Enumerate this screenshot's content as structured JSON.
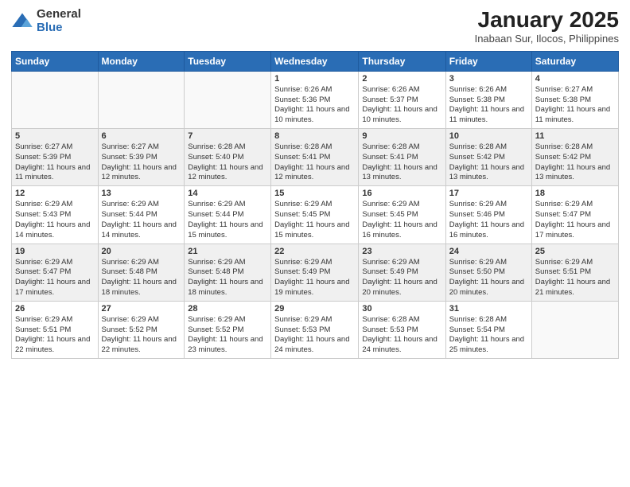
{
  "header": {
    "logo_general": "General",
    "logo_blue": "Blue",
    "title": "January 2025",
    "subtitle": "Inabaan Sur, Ilocos, Philippines"
  },
  "days_of_week": [
    "Sunday",
    "Monday",
    "Tuesday",
    "Wednesday",
    "Thursday",
    "Friday",
    "Saturday"
  ],
  "weeks": [
    [
      {
        "day": "",
        "content": ""
      },
      {
        "day": "",
        "content": ""
      },
      {
        "day": "",
        "content": ""
      },
      {
        "day": "1",
        "content": "Sunrise: 6:26 AM\nSunset: 5:36 PM\nDaylight: 11 hours and 10 minutes."
      },
      {
        "day": "2",
        "content": "Sunrise: 6:26 AM\nSunset: 5:37 PM\nDaylight: 11 hours and 10 minutes."
      },
      {
        "day": "3",
        "content": "Sunrise: 6:26 AM\nSunset: 5:38 PM\nDaylight: 11 hours and 11 minutes."
      },
      {
        "day": "4",
        "content": "Sunrise: 6:27 AM\nSunset: 5:38 PM\nDaylight: 11 hours and 11 minutes."
      }
    ],
    [
      {
        "day": "5",
        "content": "Sunrise: 6:27 AM\nSunset: 5:39 PM\nDaylight: 11 hours and 11 minutes."
      },
      {
        "day": "6",
        "content": "Sunrise: 6:27 AM\nSunset: 5:39 PM\nDaylight: 11 hours and 12 minutes."
      },
      {
        "day": "7",
        "content": "Sunrise: 6:28 AM\nSunset: 5:40 PM\nDaylight: 11 hours and 12 minutes."
      },
      {
        "day": "8",
        "content": "Sunrise: 6:28 AM\nSunset: 5:41 PM\nDaylight: 11 hours and 12 minutes."
      },
      {
        "day": "9",
        "content": "Sunrise: 6:28 AM\nSunset: 5:41 PM\nDaylight: 11 hours and 13 minutes."
      },
      {
        "day": "10",
        "content": "Sunrise: 6:28 AM\nSunset: 5:42 PM\nDaylight: 11 hours and 13 minutes."
      },
      {
        "day": "11",
        "content": "Sunrise: 6:28 AM\nSunset: 5:42 PM\nDaylight: 11 hours and 13 minutes."
      }
    ],
    [
      {
        "day": "12",
        "content": "Sunrise: 6:29 AM\nSunset: 5:43 PM\nDaylight: 11 hours and 14 minutes."
      },
      {
        "day": "13",
        "content": "Sunrise: 6:29 AM\nSunset: 5:44 PM\nDaylight: 11 hours and 14 minutes."
      },
      {
        "day": "14",
        "content": "Sunrise: 6:29 AM\nSunset: 5:44 PM\nDaylight: 11 hours and 15 minutes."
      },
      {
        "day": "15",
        "content": "Sunrise: 6:29 AM\nSunset: 5:45 PM\nDaylight: 11 hours and 15 minutes."
      },
      {
        "day": "16",
        "content": "Sunrise: 6:29 AM\nSunset: 5:45 PM\nDaylight: 11 hours and 16 minutes."
      },
      {
        "day": "17",
        "content": "Sunrise: 6:29 AM\nSunset: 5:46 PM\nDaylight: 11 hours and 16 minutes."
      },
      {
        "day": "18",
        "content": "Sunrise: 6:29 AM\nSunset: 5:47 PM\nDaylight: 11 hours and 17 minutes."
      }
    ],
    [
      {
        "day": "19",
        "content": "Sunrise: 6:29 AM\nSunset: 5:47 PM\nDaylight: 11 hours and 17 minutes."
      },
      {
        "day": "20",
        "content": "Sunrise: 6:29 AM\nSunset: 5:48 PM\nDaylight: 11 hours and 18 minutes."
      },
      {
        "day": "21",
        "content": "Sunrise: 6:29 AM\nSunset: 5:48 PM\nDaylight: 11 hours and 18 minutes."
      },
      {
        "day": "22",
        "content": "Sunrise: 6:29 AM\nSunset: 5:49 PM\nDaylight: 11 hours and 19 minutes."
      },
      {
        "day": "23",
        "content": "Sunrise: 6:29 AM\nSunset: 5:49 PM\nDaylight: 11 hours and 20 minutes."
      },
      {
        "day": "24",
        "content": "Sunrise: 6:29 AM\nSunset: 5:50 PM\nDaylight: 11 hours and 20 minutes."
      },
      {
        "day": "25",
        "content": "Sunrise: 6:29 AM\nSunset: 5:51 PM\nDaylight: 11 hours and 21 minutes."
      }
    ],
    [
      {
        "day": "26",
        "content": "Sunrise: 6:29 AM\nSunset: 5:51 PM\nDaylight: 11 hours and 22 minutes."
      },
      {
        "day": "27",
        "content": "Sunrise: 6:29 AM\nSunset: 5:52 PM\nDaylight: 11 hours and 22 minutes."
      },
      {
        "day": "28",
        "content": "Sunrise: 6:29 AM\nSunset: 5:52 PM\nDaylight: 11 hours and 23 minutes."
      },
      {
        "day": "29",
        "content": "Sunrise: 6:29 AM\nSunset: 5:53 PM\nDaylight: 11 hours and 24 minutes."
      },
      {
        "day": "30",
        "content": "Sunrise: 6:28 AM\nSunset: 5:53 PM\nDaylight: 11 hours and 24 minutes."
      },
      {
        "day": "31",
        "content": "Sunrise: 6:28 AM\nSunset: 5:54 PM\nDaylight: 11 hours and 25 minutes."
      },
      {
        "day": "",
        "content": ""
      }
    ]
  ],
  "colors": {
    "header_bg": "#2a6db5",
    "row_odd": "#f0f0f0",
    "row_even": "#ffffff"
  }
}
